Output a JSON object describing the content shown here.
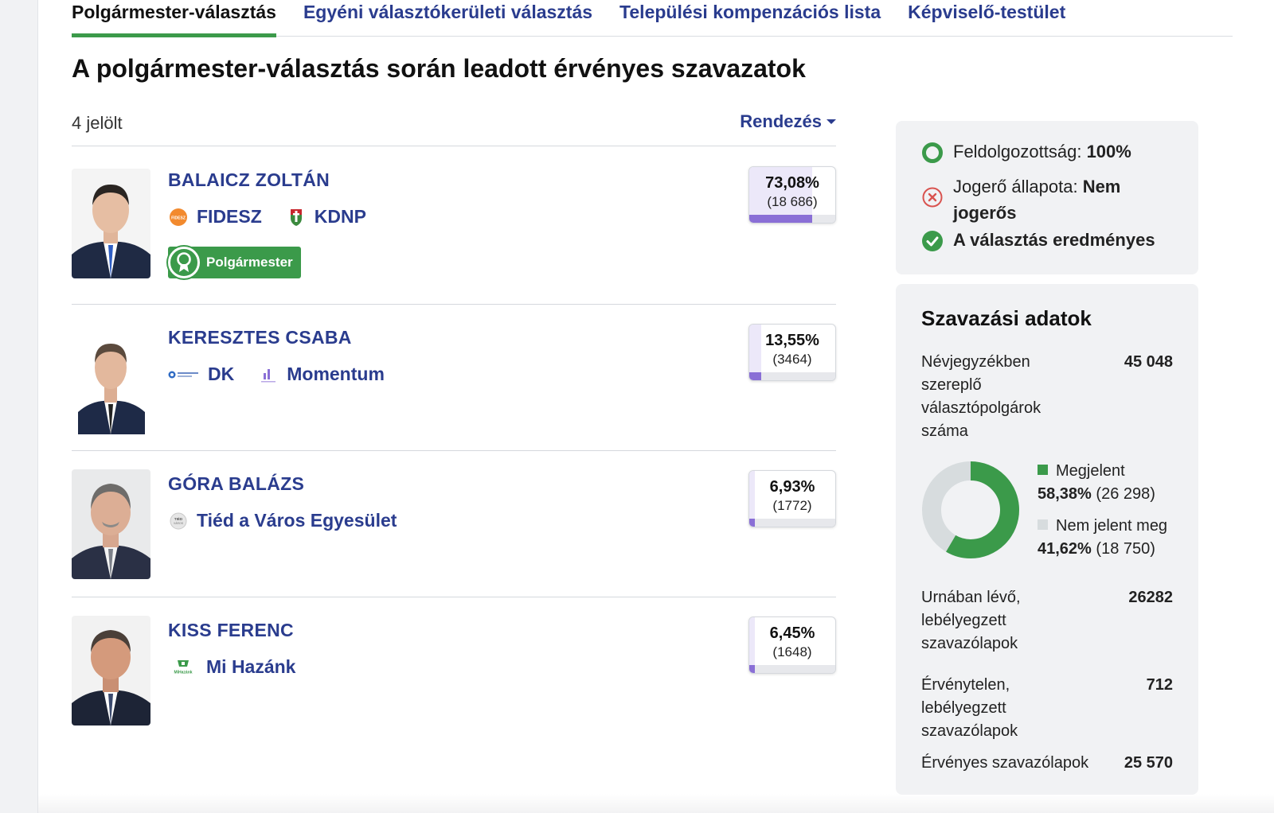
{
  "tabs": [
    {
      "label": "Polgármester-választás",
      "active": true
    },
    {
      "label": "Egyéni választókerületi választás",
      "active": false
    },
    {
      "label": "Települési kompenzációs lista",
      "active": false
    },
    {
      "label": "Képviselő-testület",
      "active": false
    }
  ],
  "page_title": "A polgármester-választás során leadott érvényes szavazatok",
  "candidate_count": "4 jelölt",
  "sort_label": "Rendezés",
  "candidates": [
    {
      "name": "BALAICZ ZOLTÁN",
      "parties": [
        {
          "name": "FIDESZ",
          "icon": "fidesz-logo-icon"
        },
        {
          "name": "KDNP",
          "icon": "kdnp-logo-icon"
        }
      ],
      "winner_badge": "Polgármester",
      "percent": "73,08%",
      "percent_value": 73.08,
      "votes": "(18 686)"
    },
    {
      "name": "KERESZTES CSABA",
      "parties": [
        {
          "name": "DK",
          "icon": "dk-logo-icon"
        },
        {
          "name": "Momentum",
          "icon": "momentum-logo-icon"
        }
      ],
      "percent": "13,55%",
      "percent_value": 13.55,
      "votes": "(3464)"
    },
    {
      "name": "GÓRA BALÁZS",
      "parties": [
        {
          "name": "Tiéd a Város Egyesület",
          "icon": "tied-a-varos-logo-icon"
        }
      ],
      "percent": "6,93%",
      "percent_value": 6.93,
      "votes": "(1772)"
    },
    {
      "name": "KISS FERENC",
      "parties": [
        {
          "name": "Mi Hazánk",
          "icon": "mi-hazank-logo-icon"
        }
      ],
      "percent": "6,45%",
      "percent_value": 6.45,
      "votes": "(1648)"
    }
  ],
  "status": {
    "processing_label": "Feldolgozottság:",
    "processing_value": "100%",
    "legal_label": "Jogerő állapota:",
    "legal_value": "Nem jogerős",
    "result_label": "A választás eredményes"
  },
  "voting_data": {
    "title": "Szavazási adatok",
    "registered_label": "Névjegyzékben szereplő választópolgárok száma",
    "registered_value": "45 048",
    "turnout": {
      "present_label": "Megjelent",
      "present_pct": "58,38%",
      "present_count": "(26 298)",
      "present_value": 58.38,
      "absent_label": "Nem jelent meg",
      "absent_pct": "41,62%",
      "absent_count": "(18 750)",
      "absent_value": 41.62,
      "present_color": "#3b9a4a",
      "absent_color": "#d7dcde"
    },
    "ballots_in_urn_label": "Urnában lévő, lebélyegzett szavazólapok",
    "ballots_in_urn_value": "26282",
    "invalid_label": "Érvénytelen, lebélyegzett szavazólapok",
    "invalid_value": "712",
    "valid_label": "Érvényes szavazólapok",
    "valid_value": "25 570"
  },
  "colors": {
    "accent_blue": "#2a3c8e",
    "green": "#3b9a4a",
    "bar_purple": "#8a6fd6",
    "error_red": "#d9534f"
  }
}
